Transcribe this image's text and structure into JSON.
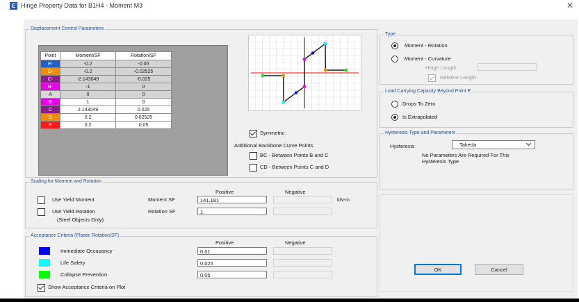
{
  "window": {
    "title": "Hinge Property Data for B1H4 - Moment M3",
    "app_icon_letter": "E",
    "close_glyph": "✕"
  },
  "displacement": {
    "group_label": "Displacement Control Parameters",
    "headers": {
      "point": "Point",
      "moment": "Moment/SF",
      "rotation": "Rotation/SF"
    },
    "rows": [
      {
        "point": "E-",
        "moment": "-0.2",
        "rotation": "-0.05",
        "color": "#1f5fc8"
      },
      {
        "point": "D-",
        "moment": "-0.2",
        "rotation": "-0.02525",
        "color": "#f08c00"
      },
      {
        "point": "C-",
        "moment": "-2.143049",
        "rotation": "-0.025",
        "color": "#8b1a8b"
      },
      {
        "point": "B-",
        "moment": "-1",
        "rotation": "0",
        "color": "#e800e8"
      },
      {
        "point": "A",
        "moment": "0",
        "rotation": "0",
        "color": "#d9d9d9"
      },
      {
        "point": "B",
        "moment": "1",
        "rotation": "0",
        "color": "#e800e8"
      },
      {
        "point": "C",
        "moment": "2.143049",
        "rotation": "0.025",
        "color": "#8b1a8b"
      },
      {
        "point": "D",
        "moment": "0.2",
        "rotation": "0.02525",
        "color": "#f08c00"
      },
      {
        "point": "E",
        "moment": "0.2",
        "rotation": "0.05",
        "color": "#ff1a1a"
      }
    ],
    "symmetric_label": "Symmetric",
    "symmetric_checked": true,
    "additional_label": "Additional Backbone Curve Points",
    "bc_label": "BC - Between Points B and C",
    "cd_label": "CD - Between Points C and D"
  },
  "scaling": {
    "group_label": "Scaling for Moment and Rotation",
    "positive_header": "Positive",
    "negative_header": "Negative",
    "use_yield_moment": "Use Yield Moment",
    "use_yield_rotation": "Use Yield Rotation",
    "steel_only": "(Steel Objects Only)",
    "moment_sf_label": "Moment SF",
    "moment_sf_value": "141.181",
    "rotation_sf_label": "Rotation SF",
    "rotation_sf_value": "1",
    "unit": "kN-m"
  },
  "acceptance": {
    "group_label": "Acceptance Criteria (Plastic Rotation/SF)",
    "positive_header": "Positive",
    "negative_header": "Negative",
    "items": [
      {
        "label": "Immediate Occupancy",
        "value": "0.01",
        "color": "#0000ff"
      },
      {
        "label": "Life Safety",
        "value": "0.025",
        "color": "#00ffff"
      },
      {
        "label": "Collapse Prevention",
        "value": "0.05",
        "color": "#00ff00"
      }
    ],
    "show_on_plot": "Show Acceptance Criteria on Plot"
  },
  "type": {
    "group_label": "Type",
    "moment_rotation": "Moment - Rotation",
    "moment_curvature": "Moment - Curvature",
    "hinge_length": "Hinge Length",
    "relative_length": "Relative Length"
  },
  "load_capacity": {
    "group_label": "Load Carrying Capacity Beyond Point E",
    "drops_to_zero": "Drops To Zero",
    "is_extrapolated": "Is Extrapolated"
  },
  "hysteresis": {
    "group_label": "Hysteresis Type and Parameters",
    "label": "Hysteresis",
    "selected": "Takeda",
    "note": "No Parameters Are Required For This Hysteresis Type"
  },
  "buttons": {
    "ok": "OK",
    "cancel": "Cancel"
  },
  "plot": {
    "accent_red": "#ff0000"
  }
}
